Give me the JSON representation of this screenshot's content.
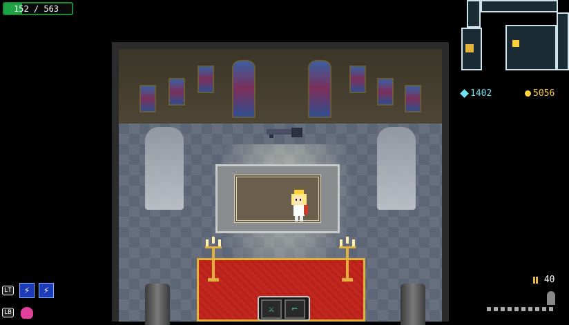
{
  "hud": {
    "health": {
      "current": 152,
      "max": 563,
      "label": "152 / 563",
      "fill_ratio": 0.27,
      "color": "#1fa347"
    },
    "gems": {
      "value": "1402",
      "icon": "gem-icon",
      "color": "#6fe0f0"
    },
    "gold": {
      "value": "5056",
      "icon": "coin-icon",
      "color": "#ffd23a"
    },
    "ammo": {
      "value": "40",
      "icon": "bullets-icon"
    },
    "skills": {
      "lt_key": "LT",
      "lb_key": "LB",
      "lt_items": [
        "lightning-skill-icon",
        "lightning-skill-icon"
      ],
      "lb_item": "health-potion-icon"
    },
    "weapon_slots": [
      {
        "name": "sword-slot",
        "icon": "sword-icon"
      },
      {
        "name": "gun-slot",
        "icon": "pistol-icon"
      }
    ]
  },
  "scene": {
    "room": "chapel",
    "accent_colors": {
      "carpet": "#c4261e",
      "trim": "#e3b23c",
      "floor": "#5d6677"
    },
    "objects": [
      "stained-glass-windows",
      "angel-statues",
      "altar",
      "hero-character",
      "dropped-gun",
      "candelabras",
      "pillars"
    ]
  }
}
